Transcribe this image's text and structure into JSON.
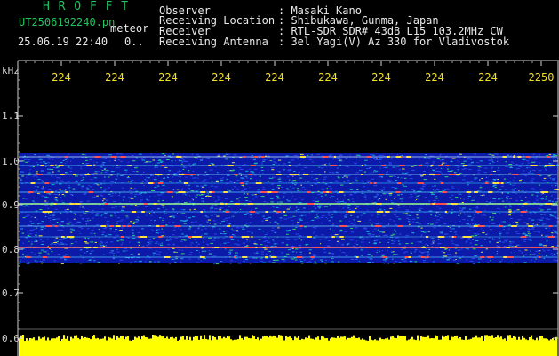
{
  "header": {
    "brand": "H R O F F T",
    "filename": "UT2506192240.pn",
    "meteor_label": "meteor",
    "datetime": "25.06.19 22:40",
    "count": "0..",
    "fields": [
      {
        "label": "Observer",
        "value": ": Masaki Kano"
      },
      {
        "label": "Receiving Location",
        "value": ": Shibukawa, Gunma, Japan"
      },
      {
        "label": "Receiver",
        "value": ": RTL-SDR SDR# 43dB L15 103.2MHz CW"
      },
      {
        "label": "Receiving Antenna",
        "value": ": 3el Yagi(V) Az 330 for Vladivostok"
      }
    ]
  },
  "axis": {
    "y_unit": "kHz",
    "y_ticks": [
      "1.1",
      "1.0",
      "0.9",
      "0.8",
      "0.7",
      "0.6"
    ],
    "x_ticks": [
      "224",
      "224",
      "224",
      "224",
      "224",
      "224",
      "224",
      "224",
      "224",
      "2250"
    ]
  },
  "colors": {
    "background": "#000000",
    "accent_green": "#22c55e",
    "tick_yellow": "#f0e020",
    "noise_blue": "#1a2fc8",
    "amplitude_yellow": "#ffff00"
  }
}
